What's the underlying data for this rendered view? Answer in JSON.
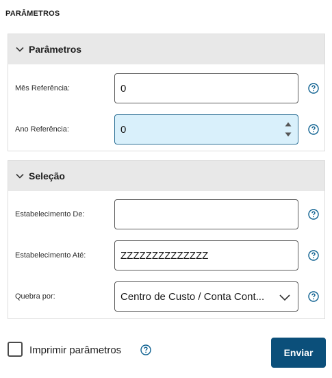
{
  "page": {
    "title": "PARÂMETROS"
  },
  "panels": [
    {
      "title": "Parâmetros",
      "fields": [
        {
          "label": "Mês Referência:",
          "value": "0"
        },
        {
          "label": "Ano Referência:",
          "value": "0"
        }
      ]
    },
    {
      "title": "Seleção",
      "fields": [
        {
          "label": "Estabelecimento De:",
          "value": ""
        },
        {
          "label": "Estabelecimento Até:",
          "value": "ZZZZZZZZZZZZZZ"
        },
        {
          "label": "Quebra por:",
          "value": "Centro de Custo / Conta Cont..."
        }
      ]
    }
  ],
  "footer": {
    "checkbox_label": "Imprimir parâmetros",
    "checkbox_checked": false,
    "submit_label": "Enviar"
  },
  "colors": {
    "accent": "#0b4f7a",
    "header_bg": "#e8e8e8",
    "focused_bg": "#d9f0fb",
    "help_icon": "#0b5f8f"
  },
  "icons": [
    "chevron-down-icon",
    "help-icon",
    "spinner-up-icon",
    "spinner-down-icon"
  ]
}
